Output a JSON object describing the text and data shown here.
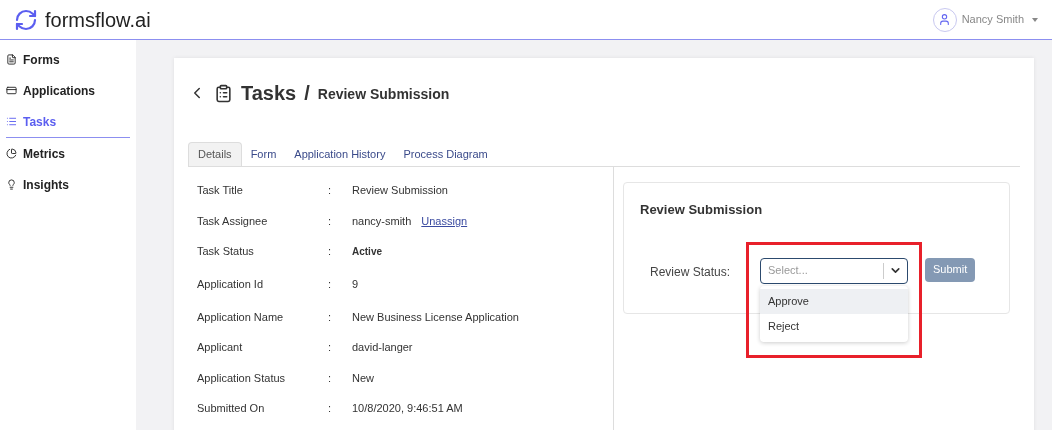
{
  "header": {
    "brand": "formsflow.ai",
    "user": "Nancy Smith"
  },
  "sidebar": {
    "items": [
      {
        "label": "Forms",
        "selected": false
      },
      {
        "label": "Applications",
        "selected": false
      },
      {
        "label": "Tasks",
        "selected": true
      },
      {
        "label": "Metrics",
        "selected": false
      },
      {
        "label": "Insights",
        "selected": false
      }
    ]
  },
  "page": {
    "title": "Tasks",
    "separator": "/",
    "subtitle": "Review Submission"
  },
  "tabs": [
    {
      "label": "Details",
      "selected": true
    },
    {
      "label": "Form",
      "selected": false
    },
    {
      "label": "Application History",
      "selected": false
    },
    {
      "label": "Process Diagram",
      "selected": false
    }
  ],
  "details": [
    {
      "label": "Task Title",
      "separator": ":",
      "value": "Review Submission"
    },
    {
      "label": "Task Assignee",
      "separator": ":",
      "value": "nancy-smith",
      "link": "Unassign"
    },
    {
      "label": "Task Status",
      "separator": ":",
      "value": "Active",
      "kind": "status"
    },
    {
      "label": "Application Id",
      "separator": ":",
      "value": "9"
    },
    {
      "label": "Application Name",
      "separator": ":",
      "value": "New Business License Application"
    },
    {
      "label": "Applicant",
      "separator": ":",
      "value": "david-langer"
    },
    {
      "label": "Application Status",
      "separator": ":",
      "value": "New"
    },
    {
      "label": "Submitted On",
      "separator": ":",
      "value": "10/8/2020, 9:46:51 AM"
    }
  ],
  "form_panel": {
    "title": "Review Submission",
    "field_label": "Review Status:",
    "select": {
      "placeholder": "Select...",
      "expanded": true,
      "options": [
        {
          "label": "Approve",
          "highlighted": true
        },
        {
          "label": "Reject",
          "highlighted": false
        }
      ]
    },
    "submit": {
      "label": "Submit",
      "disabled": true
    },
    "annotation": {
      "shown": true
    }
  }
}
